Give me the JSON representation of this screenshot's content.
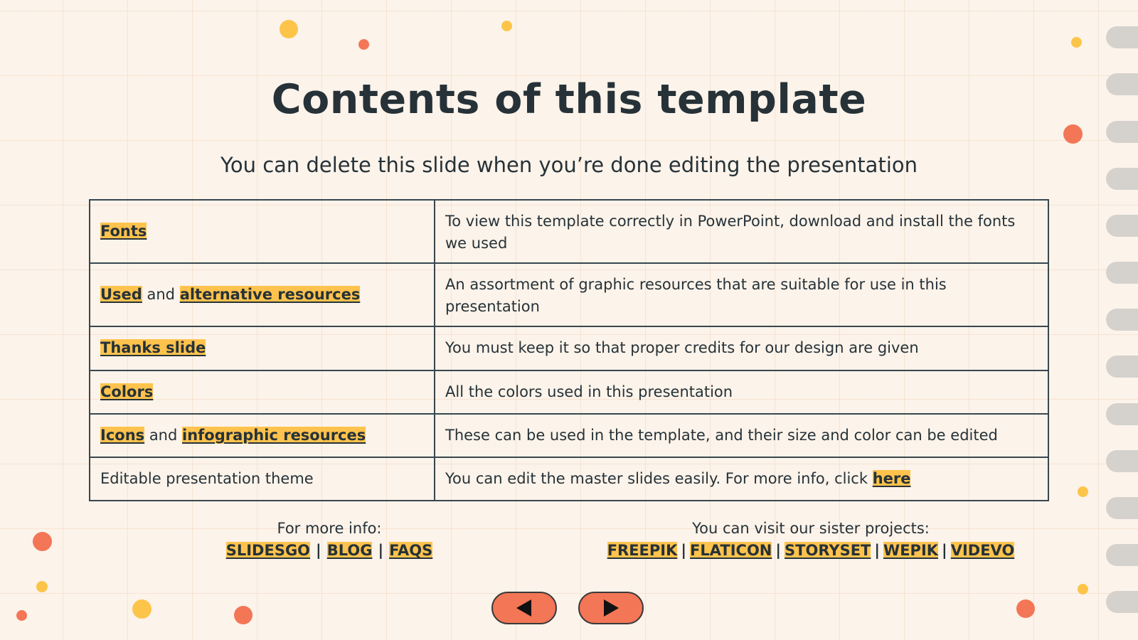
{
  "title": "Contents of this template",
  "subtitle": "You can delete this slide when you’re done editing the presentation",
  "contents_table": {
    "rows": [
      {
        "left": [
          {
            "text": "Fonts",
            "link": true
          }
        ],
        "right": [
          {
            "text": "To view this template correctly in PowerPoint, download and install the fonts we used",
            "link": false
          }
        ]
      },
      {
        "left": [
          {
            "text": "Used",
            "link": true
          },
          {
            "text": " and ",
            "link": false
          },
          {
            "text": "alternative resources",
            "link": true
          }
        ],
        "right": [
          {
            "text": "An assortment of graphic resources that are suitable for use in this presentation",
            "link": false
          }
        ]
      },
      {
        "left": [
          {
            "text": "Thanks slide",
            "link": true
          }
        ],
        "right": [
          {
            "text": "You must keep it so that proper credits for our design are given",
            "link": false
          }
        ]
      },
      {
        "left": [
          {
            "text": "Colors",
            "link": true
          }
        ],
        "right": [
          {
            "text": "All the colors used in this presentation",
            "link": false
          }
        ]
      },
      {
        "left": [
          {
            "text": "Icons",
            "link": true
          },
          {
            "text": " and ",
            "link": false
          },
          {
            "text": "infographic resources",
            "link": true
          }
        ],
        "right": [
          {
            "text": "These can be used in the template, and their size and color can be edited",
            "link": false
          }
        ]
      },
      {
        "left": [
          {
            "text": "Editable presentation theme",
            "link": false
          }
        ],
        "right": [
          {
            "text": "You can edit the master slides easily. For more info, click ",
            "link": false
          },
          {
            "text": "here",
            "link": true
          }
        ]
      }
    ]
  },
  "more_info": {
    "label": "For more info:",
    "links": [
      "SLIDESGO",
      "BLOG",
      "FAQS"
    ],
    "separator": "|"
  },
  "sister_projects": {
    "label": "You can visit our sister projects:",
    "links": [
      "FREEPIK",
      "FLATICON",
      "STORYSET",
      "WEPIK",
      "VIDEVO"
    ],
    "separator": "|"
  },
  "nav": {
    "prev_icon": "triangle-left-icon",
    "next_icon": "triangle-right-icon"
  },
  "colors": {
    "background": "#fcf3ea",
    "highlight": "#ffc34d",
    "accent_orange": "#f37656",
    "accent_yellow": "#ffc34d",
    "text": "#263238",
    "tab_gray": "#d5d2cd"
  }
}
